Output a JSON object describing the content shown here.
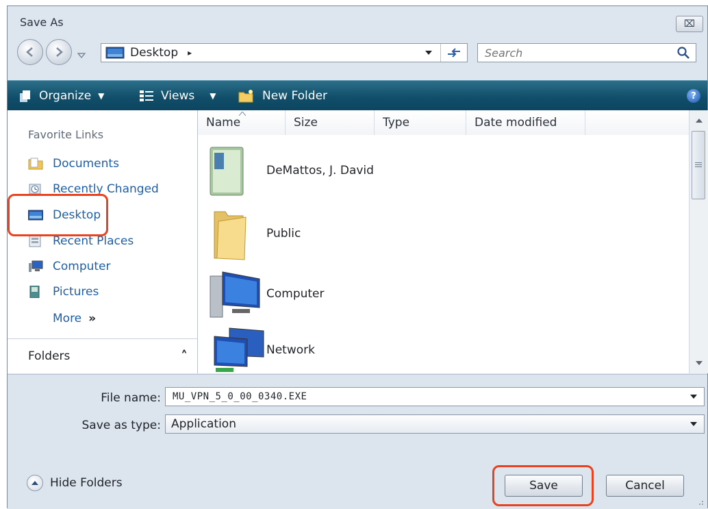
{
  "window": {
    "title": "Save As",
    "close_glyph": "⌧"
  },
  "nav": {
    "address_label": "Desktop",
    "address_separator": "▸",
    "search_placeholder": "Search"
  },
  "toolbar": {
    "organize_label": "Organize",
    "views_label": "Views",
    "new_folder_label": "New Folder",
    "help_glyph": "?"
  },
  "sidebar": {
    "heading": "Favorite Links",
    "items": [
      {
        "label": "Documents",
        "icon": "documents-folder-icon"
      },
      {
        "label": "Recently Changed",
        "icon": "recently-changed-icon"
      },
      {
        "label": "Desktop",
        "icon": "desktop-icon"
      },
      {
        "label": "Recent Places",
        "icon": "recent-places-icon"
      },
      {
        "label": "Computer",
        "icon": "computer-icon"
      },
      {
        "label": "Pictures",
        "icon": "pictures-icon"
      }
    ],
    "more_label": "More",
    "more_glyph": "»",
    "folders_label": "Folders",
    "folders_glyph": "˄"
  },
  "file_list": {
    "columns": [
      "Name",
      "Size",
      "Type",
      "Date modified"
    ],
    "items": [
      {
        "name": "DeMattos, J. David",
        "icon": "user-folder-icon"
      },
      {
        "name": "Public",
        "icon": "folder-icon"
      },
      {
        "name": "Computer",
        "icon": "computer-icon"
      },
      {
        "name": "Network",
        "icon": "network-icon"
      }
    ]
  },
  "form": {
    "file_name_label": "File name:",
    "file_name_value": "MU_VPN_5_0_00_0340.EXE",
    "save_type_label": "Save as type:",
    "save_type_value": "Application"
  },
  "footer": {
    "hide_folders_label": "Hide Folders",
    "save_label": "Save",
    "cancel_label": "Cancel"
  },
  "colors": {
    "toolbar": "#114e69",
    "highlight": "#e8421f",
    "link": "#1f5fa5"
  }
}
